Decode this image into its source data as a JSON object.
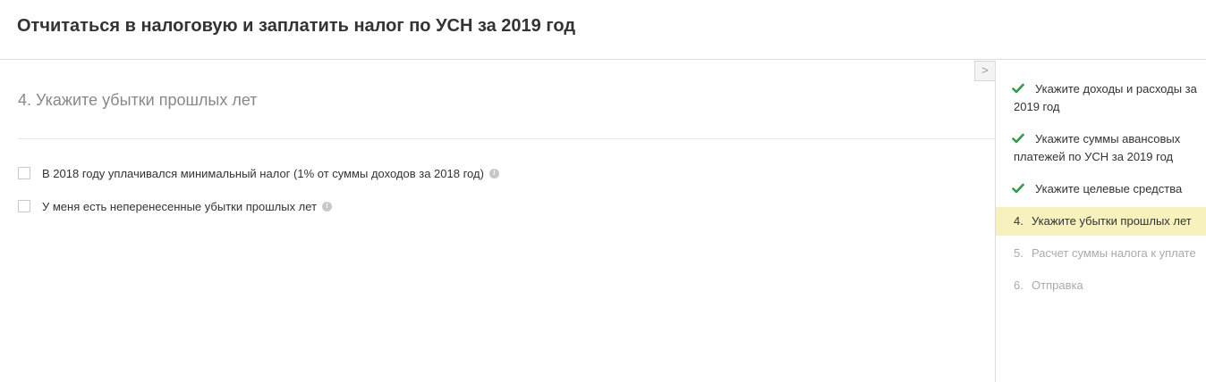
{
  "header": {
    "title": "Отчитаться в налоговую и заплатить налог по УСН за 2019 год"
  },
  "main": {
    "step_heading": "4. Укажите убытки прошлых лет",
    "checkboxes": [
      {
        "label": "В 2018 году уплачивался минимальный налог (1% от суммы доходов за 2018 год)",
        "checked": false
      },
      {
        "label": "У меня есть неперенесенные убытки прошлых лет",
        "checked": false
      }
    ],
    "info_icon": "i"
  },
  "sidebar": {
    "toggle_glyph": ">",
    "steps": [
      {
        "number": "",
        "label": "Укажите доходы и расходы за 2019 год",
        "status": "done"
      },
      {
        "number": "",
        "label": "Укажите суммы авансовых платежей по УСН за 2019 год",
        "status": "done"
      },
      {
        "number": "",
        "label": "Укажите целевые средства",
        "status": "done"
      },
      {
        "number": "4.",
        "label": "Укажите убытки прошлых лет",
        "status": "active"
      },
      {
        "number": "5.",
        "label": "Расчет суммы налога к уплате",
        "status": "pending"
      },
      {
        "number": "6.",
        "label": "Отправка",
        "status": "pending"
      }
    ]
  },
  "colors": {
    "check": "#2e9c4a",
    "active_bg": "#f6f1bd",
    "pending_text": "#aaaaaa"
  }
}
